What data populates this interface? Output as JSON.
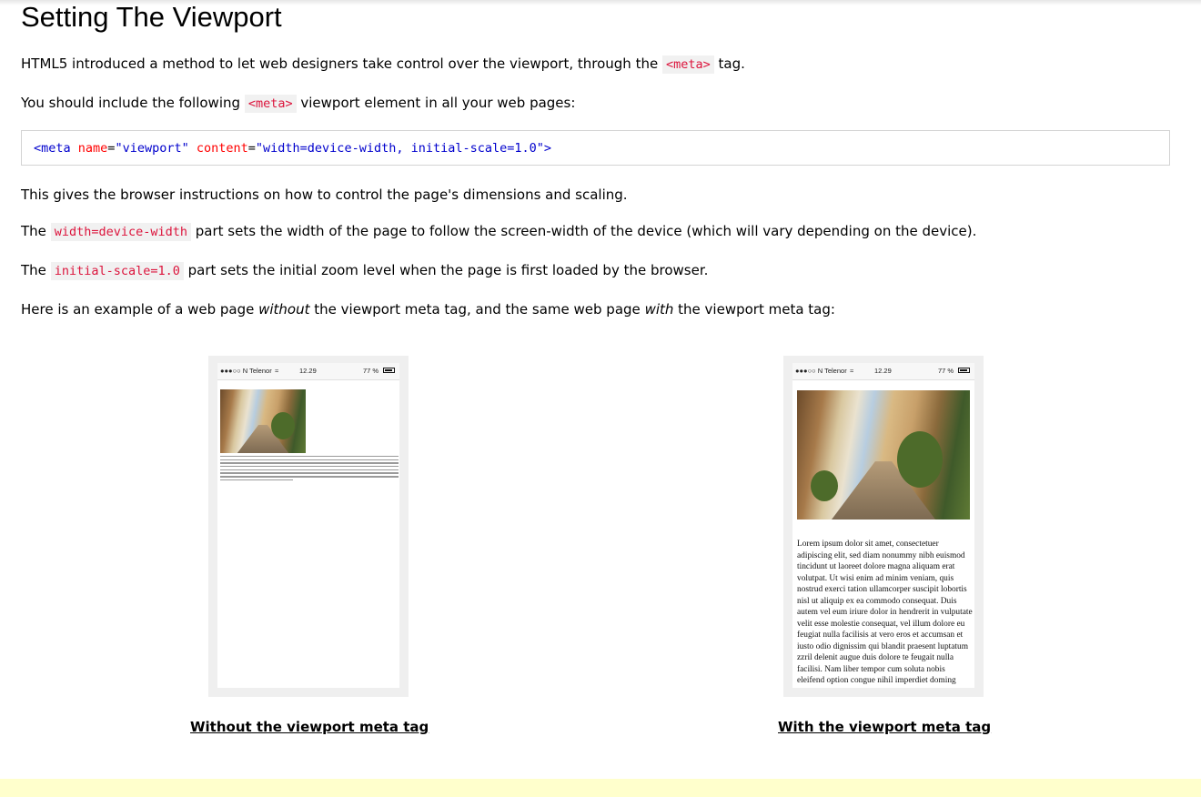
{
  "title": "Setting The Viewport",
  "p1": {
    "a": "HTML5 introduced a method to let web designers take control over the viewport, through the",
    "code": "<meta>",
    "b": "tag."
  },
  "p2": {
    "a": "You should include the following",
    "code": "<meta>",
    "b": "viewport element in all your web pages:"
  },
  "code_example": {
    "open": "<meta",
    "attr1": "name",
    "val1": "\"viewport\"",
    "attr2": "content",
    "val2": "\"width=device-width, initial-scale=1.0\"",
    "close": ">"
  },
  "p3": "This gives the browser instructions on how to control the page's dimensions and scaling.",
  "p4": {
    "a": "The",
    "code": "width=device-width",
    "b": "part sets the width of the page to follow the screen-width of the device (which will vary depending on the device)."
  },
  "p5": {
    "a": "The",
    "code": "initial-scale=1.0",
    "b": "part sets the initial zoom level when the page is first loaded by the browser."
  },
  "p6": {
    "a": "Here is an example of a web page",
    "em1": "without",
    "b": "the viewport meta tag, and the same web page",
    "em2": "with",
    "c": "the viewport meta tag:"
  },
  "phone": {
    "carrier": "●●●○○ N Telenor",
    "wifi": "᯼",
    "time": "12.29",
    "battery": "77 %"
  },
  "lorem": "Lorem ipsum dolor sit amet, consectetuer adipiscing elit, sed diam nonummy nibh euismod tincidunt ut laoreet dolore magna aliquam erat volutpat. Ut wisi enim ad minim veniam, quis nostrud exerci tation ullamcorper suscipit lobortis nisl ut aliquip ex ea commodo consequat. Duis autem vel eum iriure dolor in hendrerit in vulputate velit esse molestie consequat, vel illum dolore eu feugiat nulla facilisis at vero eros et accumsan et iusto odio dignissim qui blandit praesent luptatum zzril delenit augue duis dolore te feugait nulla facilisi. Nam liber tempor cum soluta nobis eleifend option congue nihil imperdiet doming",
  "captions": {
    "without": "Without the viewport meta tag",
    "with": "With the viewport meta tag"
  },
  "colors": {
    "code_red": "#dc143c",
    "code_bg": "#f1f1f1",
    "tag_blue": "#0000cd",
    "attr_red": "#ff0000",
    "footer_yellow": "#ffffcc"
  }
}
